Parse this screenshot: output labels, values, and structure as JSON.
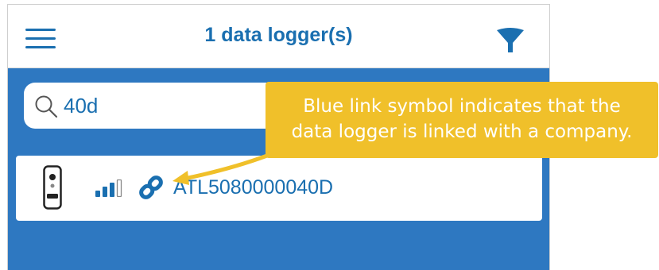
{
  "header": {
    "title": "1 data logger(s)",
    "menu_icon": "hamburger-menu-icon",
    "filter_icon": "funnel-filter-icon"
  },
  "search": {
    "value": "40d",
    "icon": "search-icon"
  },
  "logger_list": [
    {
      "device_icon": "data-logger-device-icon",
      "signal_icon": "signal-strength-icon",
      "signal_bars_filled": 3,
      "signal_bars_total": 4,
      "link_icon": "link-icon",
      "id": "ATL5080000040D"
    }
  ],
  "callout": {
    "line1": "Blue link symbol indicates that the",
    "line2": "data logger is linked with a company."
  },
  "colors": {
    "brand_blue": "#1a6fb0",
    "background_blue": "#2e78c1",
    "callout_yellow": "#f0c02a",
    "white": "#ffffff"
  }
}
